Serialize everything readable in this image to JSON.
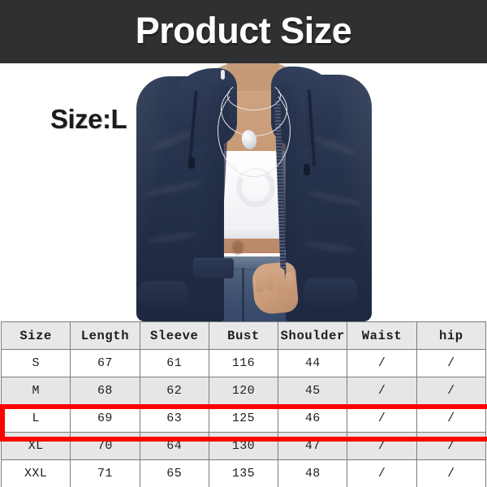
{
  "banner": {
    "title": "Product Size",
    "background_color": "#2e3032",
    "text_color": "#fdfdfd"
  },
  "photo": {
    "size_label": "Size:L",
    "garment": "navy-blue-hooded-zip-jacket",
    "inner_top": "white-crop-top",
    "bottoms": "blue-denim-jeans",
    "accessories": "layered-silver-necklaces",
    "jacket_color": "#27334c",
    "background_color": "#ffffff"
  },
  "table": {
    "headers": [
      "Size",
      "Length",
      "Sleeve",
      "Bust",
      "Shoulder",
      "Waist",
      "hip"
    ],
    "rows": [
      {
        "cells": [
          "S",
          "67",
          "61",
          "116",
          "44",
          "/",
          "/"
        ],
        "shade": "white",
        "highlighted": false
      },
      {
        "cells": [
          "M",
          "68",
          "62",
          "120",
          "45",
          "/",
          "/"
        ],
        "shade": "gray",
        "highlighted": false
      },
      {
        "cells": [
          "L",
          "69",
          "63",
          "125",
          "46",
          "/",
          "/"
        ],
        "shade": "white",
        "highlighted": true
      },
      {
        "cells": [
          "XL",
          "70",
          "64",
          "130",
          "47",
          "/",
          "/"
        ],
        "shade": "gray",
        "highlighted": false
      },
      {
        "cells": [
          "XXL",
          "71",
          "65",
          "135",
          "48",
          "/",
          "/"
        ],
        "shade": "white",
        "highlighted": false
      }
    ],
    "highlight_color": "#ff0000",
    "header_background": "#e8e8e8",
    "border_color": "#7c7c7c"
  }
}
